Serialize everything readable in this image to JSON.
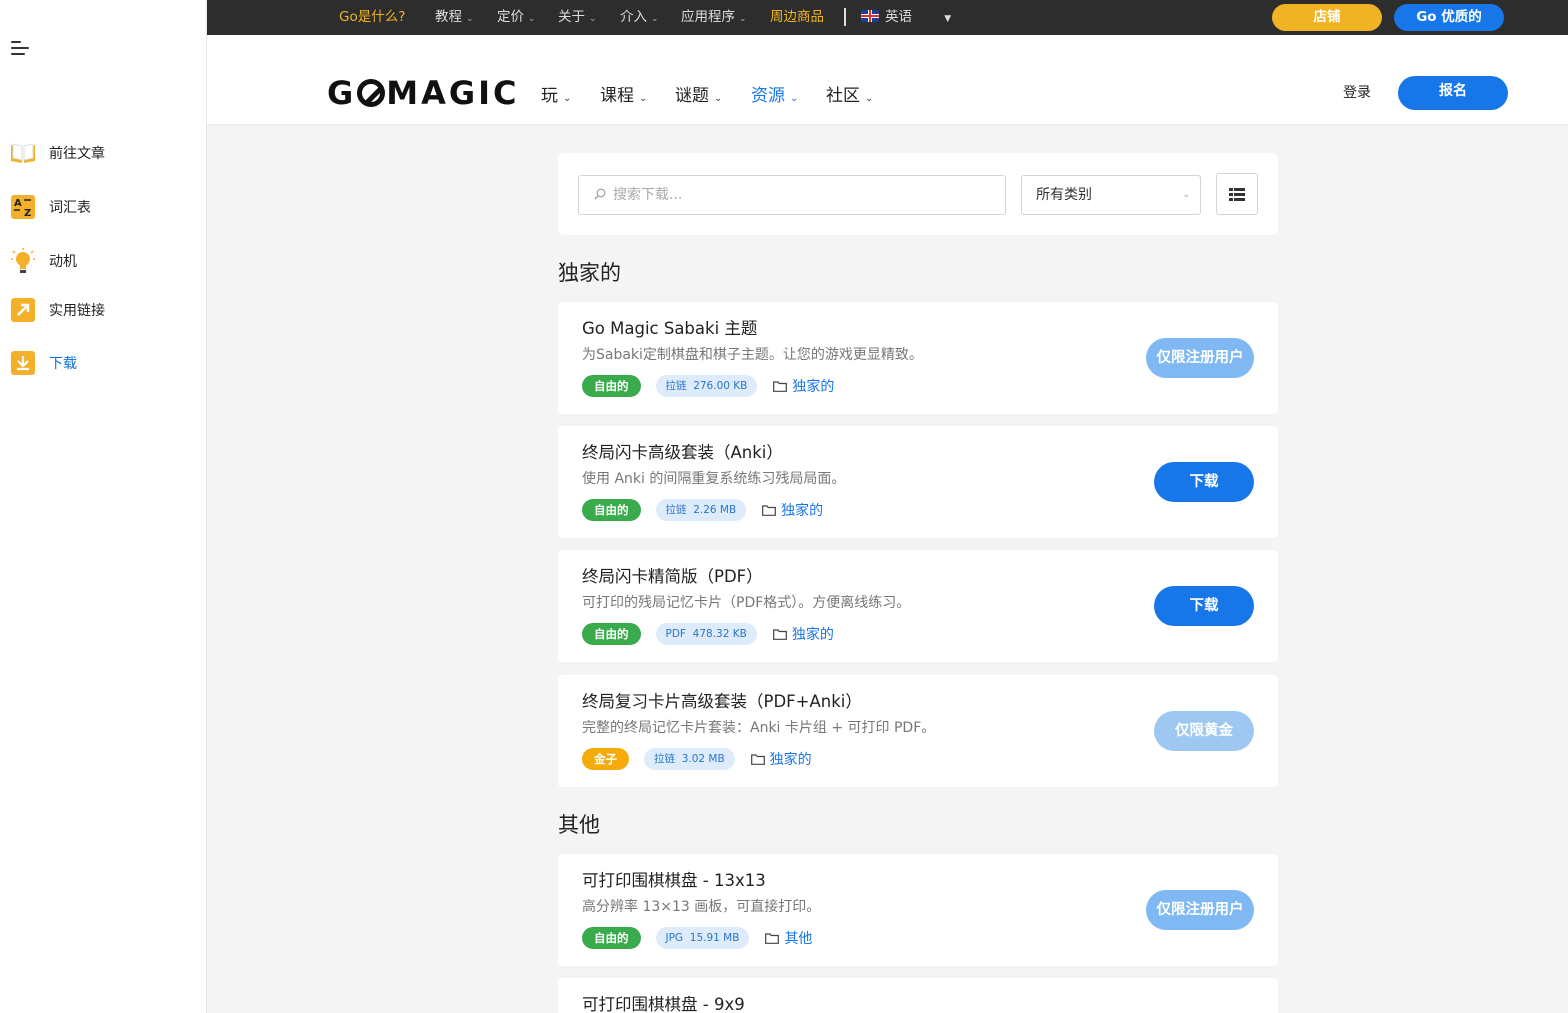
{
  "sidebar": {
    "items": [
      {
        "label": "前往文章",
        "icon": "book-icon"
      },
      {
        "label": "词汇表",
        "icon": "az-icon"
      },
      {
        "label": "动机",
        "icon": "lightbulb-icon"
      },
      {
        "label": "实用链接",
        "icon": "link-arrow-icon"
      },
      {
        "label": "下载",
        "icon": "download-icon"
      }
    ]
  },
  "topbar": {
    "items": [
      {
        "label": "Go是什么?"
      },
      {
        "label": "教程"
      },
      {
        "label": "定价"
      },
      {
        "label": "关于"
      },
      {
        "label": "介入"
      },
      {
        "label": "应用程序"
      },
      {
        "label": "周边商品"
      }
    ],
    "language": "英语",
    "shop_label": "店铺",
    "premium_label": "Go 优质的"
  },
  "header": {
    "logo": {
      "pre": "G",
      "post": "MAGIC"
    },
    "nav": [
      {
        "label": "玩"
      },
      {
        "label": "课程"
      },
      {
        "label": "谜题"
      },
      {
        "label": "资源"
      },
      {
        "label": "社区"
      }
    ],
    "login_label": "登录",
    "signup_label": "报名"
  },
  "search": {
    "placeholder": "搜索下载...",
    "category_value": "所有类别"
  },
  "sections": [
    {
      "title": "独家的",
      "items": [
        {
          "title": "Go Magic Sabaki 主题",
          "desc": "为Sabaki定制棋盘和棋子主题。让您的游戏更显精致。",
          "license": "自由的",
          "file_type": "拉链",
          "file_size": "276.00 KB",
          "category": "独家的",
          "button": "仅限注册用户"
        },
        {
          "title": "终局闪卡高级套装（Anki）",
          "desc": "使用 Anki 的间隔重复系统练习残局局面。",
          "license": "自由的",
          "file_type": "拉链",
          "file_size": "2.26 MB",
          "category": "独家的",
          "button": "下载"
        },
        {
          "title": "终局闪卡精简版（PDF）",
          "desc": "可打印的残局记忆卡片（PDF格式）。方便离线练习。",
          "license": "自由的",
          "file_type": "PDF",
          "file_size": "478.32 KB",
          "category": "独家的",
          "button": "下载"
        },
        {
          "title": "终局复习卡片高级套装（PDF+Anki）",
          "desc": "完整的终局记忆卡片套装：Anki 卡片组 + 可打印 PDF。",
          "license": "金子",
          "file_type": "拉链",
          "file_size": "3.02 MB",
          "category": "独家的",
          "button": "仅限黄金"
        }
      ]
    },
    {
      "title": "其他",
      "items": [
        {
          "title": "可打印围棋棋盘 - 13x13",
          "desc": "高分辨率 13×13 画板，可直接打印。",
          "license": "自由的",
          "file_type": "JPG",
          "file_size": "15.91 MB",
          "category": "其他",
          "button": "仅限注册用户"
        },
        {
          "title": "可打印围棋棋盘 - 9x9"
        }
      ]
    }
  ],
  "colors": {
    "accent": "#1776e8",
    "gold": "#f0b323",
    "free_badge": "#3aab4d",
    "gold_badge": "#f5ab0c"
  }
}
